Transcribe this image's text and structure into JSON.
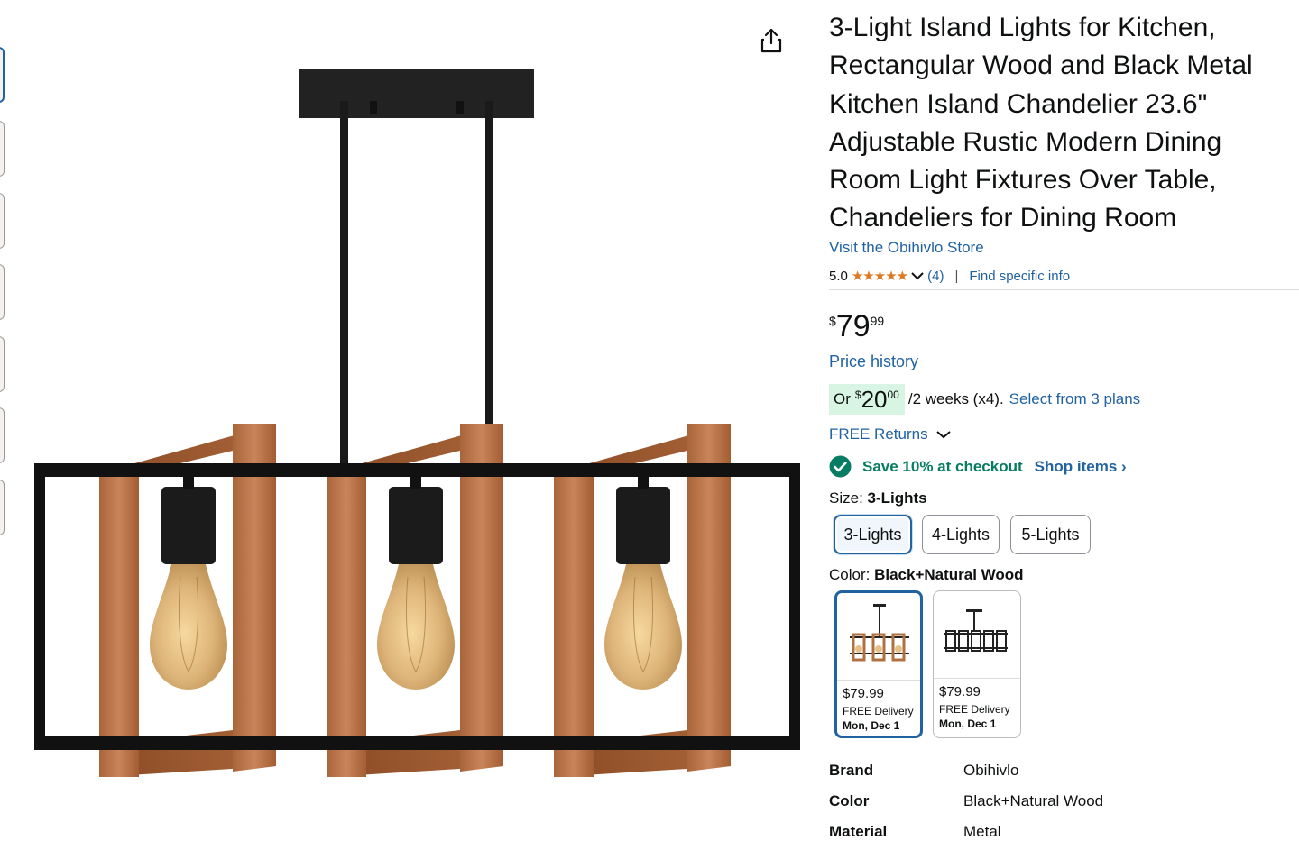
{
  "product": {
    "title": "3-Light Island Lights for Kitchen, Rectangular Wood and Black Metal Kitchen Island Chandelier 23.6\" Adjustable Rustic Modern Dining Room Light Fixtures Over Table, Chandeliers for Dining Room",
    "store_link": "Visit the Obihivlo Store",
    "rating": "5.0",
    "stars": "★★★★★",
    "rating_count": "(4)",
    "separator": "|",
    "find_info": "Find specific info"
  },
  "price": {
    "symbol": "$",
    "whole": "79",
    "fraction": "99",
    "history_link": "Price history"
  },
  "installment": {
    "prefix": "Or",
    "symbol": "$",
    "whole": "20",
    "fraction": "00",
    "terms": "/2 weeks (x4).",
    "plans_link": "Select from 3 plans"
  },
  "returns": {
    "label": "FREE Returns"
  },
  "coupon": {
    "text": "Save 10% at checkout",
    "shop_link": "Shop items ›"
  },
  "size": {
    "label": "Size:",
    "selected": "3-Lights",
    "options": [
      "3-Lights",
      "4-Lights",
      "5-Lights"
    ]
  },
  "color": {
    "label": "Color:",
    "selected": "Black+Natural Wood",
    "swatches": [
      {
        "price": "$79.99",
        "delivery": "FREE Delivery",
        "date": "Mon, Dec 1"
      },
      {
        "price": "$79.99",
        "delivery": "FREE Delivery",
        "date": "Mon, Dec 1"
      }
    ]
  },
  "specs": [
    {
      "key": "Brand",
      "value": "Obihivlo"
    },
    {
      "key": "Color",
      "value": "Black+Natural Wood"
    },
    {
      "key": "Material",
      "value": "Metal"
    }
  ],
  "colors": {
    "link": "#2162a1",
    "star": "#de7921",
    "coupon_green": "#067d62",
    "installment_bg": "#d8f5e3",
    "selected_border": "#2162a1"
  }
}
